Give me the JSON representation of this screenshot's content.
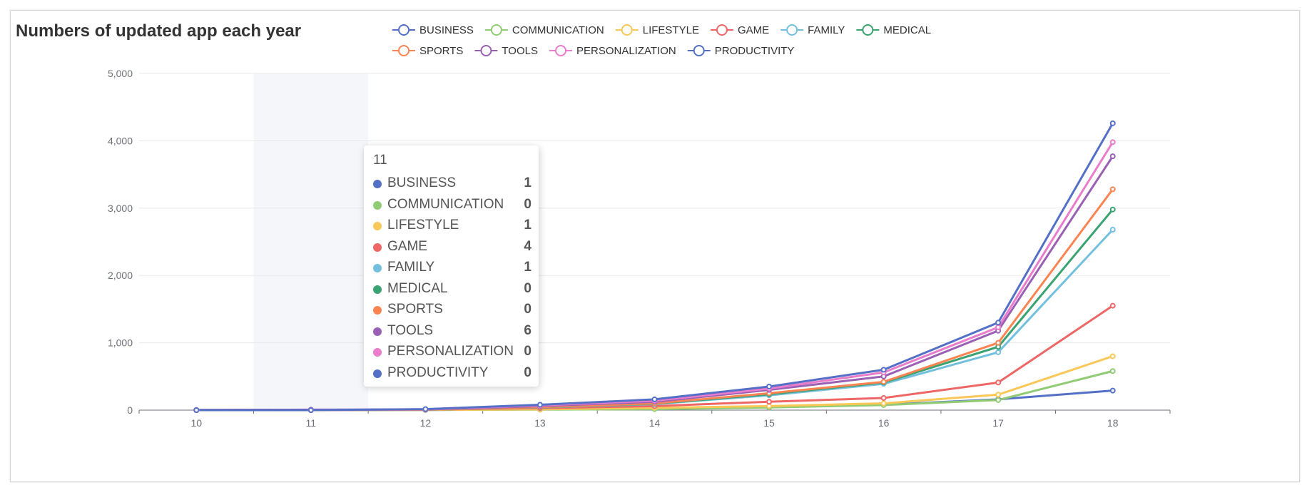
{
  "chart_data": {
    "type": "line",
    "title": "Numbers of updated app each year",
    "categories": [
      "10",
      "11",
      "12",
      "13",
      "14",
      "15",
      "16",
      "17",
      "18"
    ],
    "y_ticks": [
      "0",
      "1,000",
      "2,000",
      "3,000",
      "4,000",
      "5,000"
    ],
    "ylim": [
      0,
      5000
    ],
    "grid": "horizontal",
    "legend_position": "top",
    "highlighted_category": "11",
    "series": [
      {
        "name": "BUSINESS",
        "color": "#5470c6",
        "values": [
          0,
          1,
          3,
          12,
          25,
          45,
          80,
          160,
          290
        ]
      },
      {
        "name": "COMMUNICATION",
        "color": "#91cc75",
        "values": [
          0,
          0,
          2,
          8,
          15,
          40,
          75,
          150,
          580
        ]
      },
      {
        "name": "LIFESTYLE",
        "color": "#fac858",
        "values": [
          0,
          1,
          4,
          12,
          35,
          60,
          100,
          230,
          800
        ]
      },
      {
        "name": "GAME",
        "color": "#ee6666",
        "values": [
          1,
          4,
          8,
          30,
          60,
          125,
          180,
          410,
          1550
        ]
      },
      {
        "name": "FAMILY",
        "color": "#73c0de",
        "values": [
          1,
          1,
          6,
          40,
          90,
          220,
          390,
          860,
          2680
        ]
      },
      {
        "name": "MEDICAL",
        "color": "#3ba272",
        "values": [
          0,
          0,
          6,
          42,
          95,
          235,
          410,
          940,
          2980
        ]
      },
      {
        "name": "SPORTS",
        "color": "#fc8452",
        "values": [
          0,
          0,
          7,
          45,
          100,
          250,
          420,
          1000,
          3280
        ]
      },
      {
        "name": "TOOLS",
        "color": "#9a60b4",
        "values": [
          2,
          6,
          10,
          60,
          125,
          300,
          500,
          1180,
          3770
        ]
      },
      {
        "name": "PERSONALIZATION",
        "color": "#ea7ccc",
        "values": [
          0,
          0,
          12,
          70,
          140,
          320,
          560,
          1230,
          3980
        ]
      },
      {
        "name": "PRODUCTIVITY",
        "color": "#5470c6",
        "values": [
          0,
          0,
          15,
          80,
          160,
          350,
          600,
          1300,
          4260
        ]
      }
    ]
  },
  "tooltip": {
    "title": "11",
    "rows": [
      {
        "name": "BUSINESS",
        "value": "1",
        "color": "#5470c6"
      },
      {
        "name": "COMMUNICATION",
        "value": "0",
        "color": "#91cc75"
      },
      {
        "name": "LIFESTYLE",
        "value": "1",
        "color": "#fac858"
      },
      {
        "name": "GAME",
        "value": "4",
        "color": "#ee6666"
      },
      {
        "name": "FAMILY",
        "value": "1",
        "color": "#73c0de"
      },
      {
        "name": "MEDICAL",
        "value": "0",
        "color": "#3ba272"
      },
      {
        "name": "SPORTS",
        "value": "0",
        "color": "#fc8452"
      },
      {
        "name": "TOOLS",
        "value": "6",
        "color": "#9a60b4"
      },
      {
        "name": "PERSONALIZATION",
        "value": "0",
        "color": "#ea7ccc"
      },
      {
        "name": "PRODUCTIVITY",
        "value": "0",
        "color": "#5470c6"
      }
    ]
  }
}
